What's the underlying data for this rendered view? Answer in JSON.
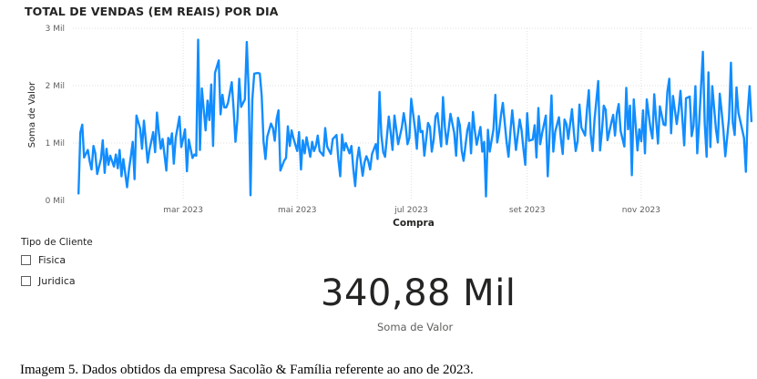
{
  "chart_data": {
    "type": "line",
    "title": "TOTAL DE VENDAS (EM REAIS) POR DIA",
    "xlabel": "Compra",
    "ylabel": "Soma de Valor",
    "y_ticks": [
      "0 Mil",
      "1 Mil",
      "2 Mil",
      "3 Mil"
    ],
    "ylim": [
      0,
      3000
    ],
    "x_tick_labels": [
      "mar 2023",
      "mai 2023",
      "jul 2023",
      "set 2023",
      "nov 2023"
    ],
    "x_range": [
      "2023-01-01",
      "2023-12-31"
    ],
    "grid": true,
    "series_color": "#118DFF",
    "x": [
      "2023-01-04",
      "2023-01-05",
      "2023-01-06",
      "2023-01-07",
      "2023-01-09",
      "2023-01-10",
      "2023-01-11",
      "2023-01-12",
      "2023-01-13",
      "2023-01-14",
      "2023-01-16",
      "2023-01-17",
      "2023-01-18",
      "2023-01-19",
      "2023-01-20",
      "2023-01-21",
      "2023-01-23",
      "2023-01-24",
      "2023-01-25",
      "2023-01-26",
      "2023-01-27",
      "2023-01-28",
      "2023-01-30",
      "2023-01-31",
      "2023-02-01",
      "2023-02-02",
      "2023-02-03",
      "2023-02-04",
      "2023-02-06",
      "2023-02-07",
      "2023-02-08",
      "2023-02-09",
      "2023-02-10",
      "2023-02-11",
      "2023-02-13",
      "2023-02-14",
      "2023-02-15",
      "2023-02-16",
      "2023-02-17",
      "2023-02-18",
      "2023-02-20",
      "2023-02-21",
      "2023-02-22",
      "2023-02-23",
      "2023-02-24",
      "2023-02-25",
      "2023-02-27",
      "2023-02-28",
      "2023-03-01",
      "2023-03-02",
      "2023-03-03",
      "2023-03-04",
      "2023-03-06",
      "2023-03-07",
      "2023-03-08",
      "2023-03-09",
      "2023-03-10",
      "2023-03-11",
      "2023-03-13",
      "2023-03-14",
      "2023-03-15",
      "2023-03-16",
      "2023-03-17",
      "2023-03-18",
      "2023-03-20",
      "2023-03-21",
      "2023-03-22",
      "2023-03-23",
      "2023-03-24",
      "2023-03-25",
      "2023-03-27",
      "2023-03-28",
      "2023-03-29",
      "2023-03-30",
      "2023-03-31",
      "2023-04-01",
      "2023-04-03",
      "2023-04-04",
      "2023-04-05",
      "2023-04-06",
      "2023-04-07",
      "2023-04-08",
      "2023-04-10",
      "2023-04-11",
      "2023-04-12",
      "2023-04-13",
      "2023-04-14",
      "2023-04-15",
      "2023-04-17",
      "2023-04-18",
      "2023-04-19",
      "2023-04-20",
      "2023-04-21",
      "2023-04-22",
      "2023-04-24",
      "2023-04-25",
      "2023-04-26",
      "2023-04-27",
      "2023-04-28",
      "2023-04-29",
      "2023-05-01",
      "2023-05-02",
      "2023-05-03",
      "2023-05-04",
      "2023-05-05",
      "2023-05-06",
      "2023-05-08",
      "2023-05-09",
      "2023-05-10",
      "2023-05-11",
      "2023-05-12",
      "2023-05-13",
      "2023-05-15",
      "2023-05-16",
      "2023-05-17",
      "2023-05-18",
      "2023-05-19",
      "2023-05-20",
      "2023-05-22",
      "2023-05-23",
      "2023-05-24",
      "2023-05-25",
      "2023-05-26",
      "2023-05-27",
      "2023-05-29",
      "2023-05-30",
      "2023-05-31",
      "2023-06-01",
      "2023-06-02",
      "2023-06-03",
      "2023-06-05",
      "2023-06-06",
      "2023-06-07",
      "2023-06-08",
      "2023-06-09",
      "2023-06-10",
      "2023-06-12",
      "2023-06-13",
      "2023-06-14",
      "2023-06-15",
      "2023-06-16",
      "2023-06-17",
      "2023-06-19",
      "2023-06-20",
      "2023-06-21",
      "2023-06-22",
      "2023-06-23",
      "2023-06-24",
      "2023-06-26",
      "2023-06-27",
      "2023-06-28",
      "2023-06-29",
      "2023-06-30",
      "2023-07-01",
      "2023-07-03",
      "2023-07-04",
      "2023-07-05",
      "2023-07-06",
      "2023-07-07",
      "2023-07-08",
      "2023-07-10",
      "2023-07-11",
      "2023-07-12",
      "2023-07-13",
      "2023-07-14",
      "2023-07-15",
      "2023-07-17",
      "2023-07-18",
      "2023-07-19",
      "2023-07-20",
      "2023-07-21",
      "2023-07-22",
      "2023-07-24",
      "2023-07-25",
      "2023-07-26",
      "2023-07-27",
      "2023-07-28",
      "2023-07-29",
      "2023-07-31",
      "2023-08-01",
      "2023-08-02",
      "2023-08-03",
      "2023-08-04",
      "2023-08-05",
      "2023-08-07",
      "2023-08-08",
      "2023-08-09",
      "2023-08-10",
      "2023-08-11",
      "2023-08-12",
      "2023-08-14",
      "2023-08-15",
      "2023-08-16",
      "2023-08-17",
      "2023-08-18",
      "2023-08-19",
      "2023-08-21",
      "2023-08-22",
      "2023-08-23",
      "2023-08-24",
      "2023-08-25",
      "2023-08-26",
      "2023-08-28",
      "2023-08-29",
      "2023-08-30",
      "2023-08-31",
      "2023-09-01",
      "2023-09-02",
      "2023-09-04",
      "2023-09-05",
      "2023-09-06",
      "2023-09-07",
      "2023-09-08",
      "2023-09-09",
      "2023-09-11",
      "2023-09-12",
      "2023-09-13",
      "2023-09-14",
      "2023-09-15",
      "2023-09-16",
      "2023-09-18",
      "2023-09-19",
      "2023-09-20",
      "2023-09-21",
      "2023-09-22",
      "2023-09-23",
      "2023-09-25",
      "2023-09-26",
      "2023-09-27",
      "2023-09-28",
      "2023-09-29",
      "2023-09-30",
      "2023-10-02",
      "2023-10-03",
      "2023-10-04",
      "2023-10-05",
      "2023-10-06",
      "2023-10-07",
      "2023-10-09",
      "2023-10-10",
      "2023-10-11",
      "2023-10-12",
      "2023-10-13",
      "2023-10-14",
      "2023-10-16",
      "2023-10-17",
      "2023-10-18",
      "2023-10-19",
      "2023-10-20",
      "2023-10-21",
      "2023-10-23",
      "2023-10-24",
      "2023-10-25",
      "2023-10-26",
      "2023-10-27",
      "2023-10-28",
      "2023-10-30",
      "2023-10-31",
      "2023-11-01",
      "2023-11-02",
      "2023-11-03",
      "2023-11-04",
      "2023-11-06",
      "2023-11-07",
      "2023-11-08",
      "2023-11-09",
      "2023-11-10",
      "2023-11-11",
      "2023-11-13",
      "2023-11-14",
      "2023-11-15",
      "2023-11-16",
      "2023-11-17",
      "2023-11-18",
      "2023-11-20",
      "2023-11-21",
      "2023-11-22",
      "2023-11-23",
      "2023-11-24",
      "2023-11-25",
      "2023-11-27",
      "2023-11-28",
      "2023-11-29",
      "2023-11-30",
      "2023-12-01",
      "2023-12-02",
      "2023-12-04",
      "2023-12-05",
      "2023-12-06",
      "2023-12-07",
      "2023-12-08",
      "2023-12-09",
      "2023-12-11",
      "2023-12-12",
      "2023-12-13",
      "2023-12-14",
      "2023-12-15",
      "2023-12-16",
      "2023-12-18",
      "2023-12-19",
      "2023-12-20",
      "2023-12-21",
      "2023-12-22",
      "2023-12-23",
      "2023-12-26",
      "2023-12-27",
      "2023-12-28",
      "2023-12-29",
      "2023-12-30"
    ],
    "values": [
      120,
      1180,
      1320,
      750,
      880,
      680,
      540,
      950,
      820,
      460,
      720,
      1050,
      480,
      900,
      620,
      780,
      590,
      800,
      560,
      880,
      420,
      720,
      230,
      540,
      760,
      1020,
      370,
      1480,
      1250,
      900,
      1390,
      1050,
      660,
      880,
      1190,
      840,
      1530,
      1180,
      900,
      1070,
      520,
      1090,
      980,
      1170,
      640,
      1090,
      1460,
      930,
      1080,
      1240,
      510,
      1060,
      740,
      800,
      780,
      2800,
      880,
      1950,
      1220,
      1740,
      1400,
      2020,
      950,
      2220,
      2440,
      1500,
      1840,
      1620,
      1620,
      1700,
      2060,
      1580,
      1020,
      1410,
      2120,
      1630,
      1760,
      2760,
      1950,
      90,
      1760,
      2210,
      2220,
      2210,
      1820,
      1030,
      720,
      1110,
      1340,
      1260,
      1040,
      1420,
      1570,
      520,
      690,
      740,
      1290,
      950,
      1220,
      1080,
      860,
      1190,
      540,
      1050,
      820,
      1100,
      760,
      1020,
      860,
      950,
      1130,
      860,
      780,
      1260,
      940,
      870,
      810,
      1070,
      1140,
      720,
      420,
      1150,
      870,
      1000,
      820,
      950,
      560,
      250,
      690,
      920,
      430,
      660,
      770,
      690,
      540,
      810,
      980,
      720,
      1890,
      1150,
      840,
      760,
      1460,
      1180,
      880,
      1480,
      1240,
      980,
      1280,
      1520,
      1310,
      980,
      1090,
      1770,
      1250,
      900,
      1470,
      1190,
      1210,
      780,
      1350,
      1280,
      850,
      1060,
      1460,
      1520,
      940,
      1800,
      1270,
      980,
      1240,
      1510,
      1180,
      780,
      1440,
      1310,
      860,
      690,
      1220,
      1350,
      820,
      1540,
      1220,
      970,
      1280,
      850,
      1020,
      70,
      1230,
      850,
      1240,
      1840,
      1010,
      1200,
      1490,
      1700,
      1020,
      760,
      1180,
      1570,
      1240,
      880,
      1410,
      1230,
      900,
      620,
      1520,
      1040,
      1060,
      1310,
      750,
      1610,
      980,
      1170,
      1480,
      420,
      1140,
      1830,
      850,
      1200,
      1450,
      1090,
      810,
      1410,
      1330,
      1070,
      1590,
      1180,
      860,
      1040,
      1670,
      1270,
      1130,
      1590,
      1920,
      1150,
      860,
      1400,
      2080,
      870,
      1210,
      1650,
      1580,
      1050,
      1350,
      1490,
      1130,
      1520,
      1680,
      1210,
      940,
      1960,
      1240,
      1650,
      440,
      1760,
      870,
      1240,
      1030,
      1570,
      820,
      1760,
      1250,
      1080,
      1850,
      1390,
      990,
      1640,
      1320,
      1310,
      1890,
      2120,
      1170,
      1820,
      1330,
      1560,
      1910,
      1440,
      960,
      1780,
      1810,
      1120,
      1300,
      1990,
      820,
      1350,
      2590,
      1350,
      760,
      2230,
      930,
      1990,
      1230,
      1010,
      1860,
      1560,
      1210,
      770,
      1430,
      2400,
      1360,
      1140,
      1970,
      1530,
      1090,
      500,
      1540,
      1990,
      1380,
      1600,
      1970,
      1110,
      890,
      2000,
      1690,
      990,
      50,
      1420,
      1060,
      1400,
      920,
      550
    ]
  },
  "slicer": {
    "title": "Tipo de Cliente",
    "items": [
      "Fisica",
      "Juridica"
    ]
  },
  "kpi": {
    "value": "340,88 Mil",
    "label": "Soma de Valor"
  },
  "caption": "Imagem 5. Dados obtidos da empresa Sacolão & Família referente ao ano de 2023."
}
